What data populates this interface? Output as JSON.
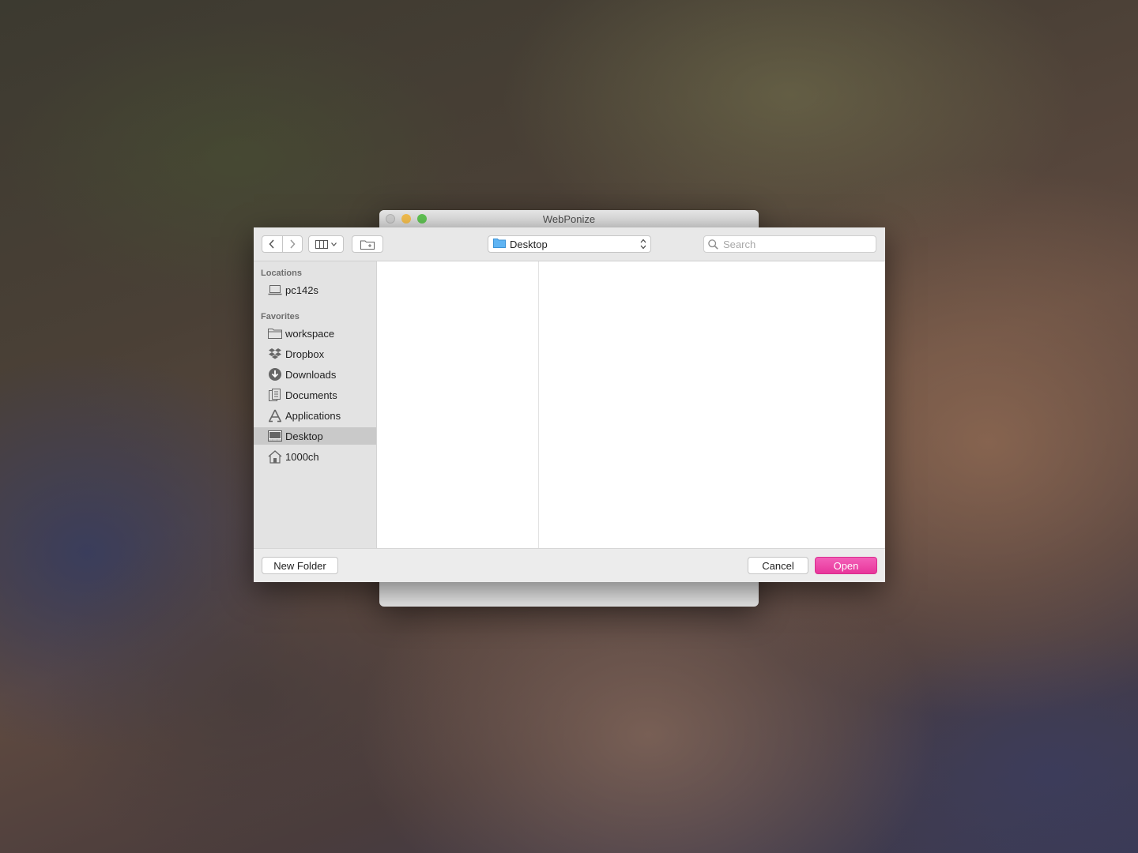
{
  "window": {
    "title": "WebPonize"
  },
  "toolbar": {
    "back_icon": "chevron-left-icon",
    "forward_icon": "chevron-right-icon",
    "view_icon": "column-view-icon",
    "new_folder_icon": "folder-plus-icon",
    "path": "Desktop",
    "search_placeholder": "Search"
  },
  "sidebar": {
    "locations_title": "Locations",
    "locations": [
      {
        "label": "pc142s",
        "icon": "laptop-icon"
      }
    ],
    "favorites_title": "Favorites",
    "favorites": [
      {
        "label": "workspace",
        "icon": "folder-icon"
      },
      {
        "label": "Dropbox",
        "icon": "dropbox-icon"
      },
      {
        "label": "Downloads",
        "icon": "downloads-icon"
      },
      {
        "label": "Documents",
        "icon": "documents-icon"
      },
      {
        "label": "Applications",
        "icon": "applications-icon"
      },
      {
        "label": "Desktop",
        "icon": "desktop-icon",
        "selected": true
      },
      {
        "label": "1000ch",
        "icon": "home-icon"
      }
    ]
  },
  "footer": {
    "new_folder_label": "New Folder",
    "cancel_label": "Cancel",
    "open_label": "Open"
  },
  "colors": {
    "accent": "#ec3fa4"
  }
}
